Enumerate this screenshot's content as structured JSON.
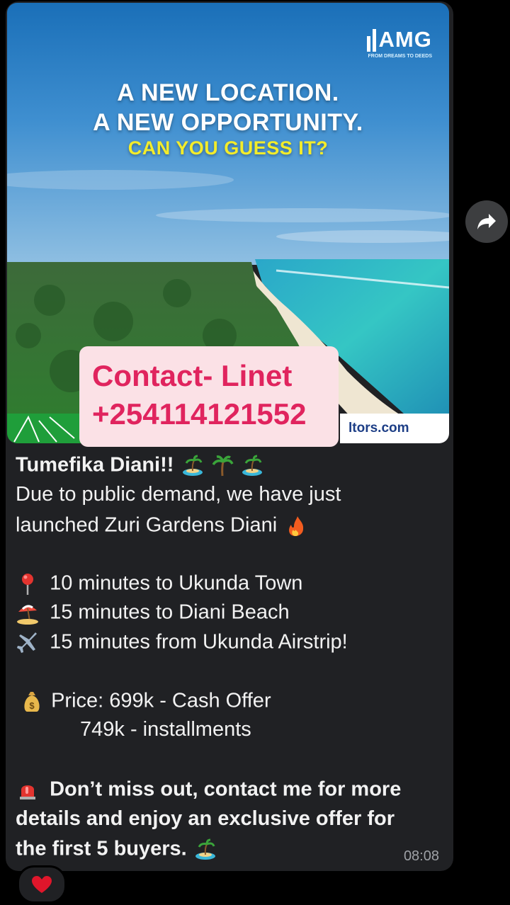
{
  "image": {
    "brand_name": "AMG",
    "brand_tagline": "FROM DREAMS TO DEEDS",
    "headline_1": "A NEW LOCATION.",
    "headline_2": "A NEW OPPORTUNITY.",
    "headline_3": "CAN YOU GUESS IT?",
    "contact_name": "Contact- Linet",
    "contact_phone": "+254114121552",
    "website_fragment": "ltors.com"
  },
  "message": {
    "title": "Tumefika Diani!!",
    "line_1": "Due to public demand, we have just",
    "line_2": "launched Zuri Gardens Diani",
    "bullet_1": "10 minutes to Ukunda Town",
    "bullet_2": "15 minutes to Diani Beach",
    "bullet_3": "15 minutes from Ukunda Airstrip!",
    "price_1": "Price: 699k - Cash Offer",
    "price_2": "749k - installments",
    "cta_1": "Don’t miss out, contact me for more",
    "cta_2": "details and enjoy an exclusive offer for",
    "cta_3": "the first 5 buyers.",
    "time": "08:08"
  },
  "icons": {
    "share": "share-arrow-icon",
    "reaction": "heart-icon",
    "island": "island-icon",
    "palm": "palm-tree-icon",
    "fire": "fire-icon",
    "pin": "round-pushpin-icon",
    "beach": "beach-umbrella-icon",
    "plane": "airplane-icon",
    "money": "money-bag-icon",
    "siren": "siren-icon"
  },
  "colors": {
    "bubble": "#202124",
    "accent_pink": "#e0245e",
    "headline_yellow": "#f3ec2a"
  }
}
